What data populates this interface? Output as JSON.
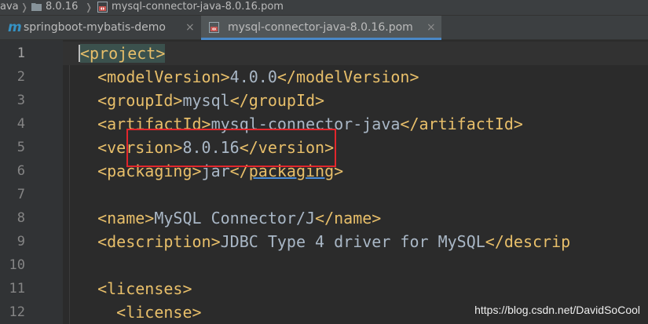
{
  "breadcrumb": {
    "items": [
      "ava",
      "8.0.16",
      "mysql-connector-java-8.0.16.pom"
    ]
  },
  "tabs": [
    {
      "label": "springboot-mybatis-demo",
      "icon": "maven-m-icon",
      "active": false
    },
    {
      "label": "mysql-connector-java-8.0.16.pom",
      "icon": "pom-file-icon",
      "active": true
    }
  ],
  "close_glyph": "×",
  "editor": {
    "line_numbers": [
      "1",
      "2",
      "3",
      "4",
      "5",
      "6",
      "7",
      "8",
      "9",
      "10",
      "11",
      "12"
    ],
    "lines": [
      {
        "indent": "",
        "segments": [
          {
            "t": "<project>",
            "c": "tag-match"
          }
        ]
      },
      {
        "indent": "  ",
        "segments": [
          {
            "t": "<modelVersion>",
            "c": "tag"
          },
          {
            "t": "4.0.0",
            "c": "text"
          },
          {
            "t": "</modelVersion>",
            "c": "tag"
          }
        ]
      },
      {
        "indent": "  ",
        "segments": [
          {
            "t": "<groupId>",
            "c": "tag"
          },
          {
            "t": "mysql",
            "c": "text"
          },
          {
            "t": "</groupId>",
            "c": "tag"
          }
        ]
      },
      {
        "indent": "  ",
        "segments": [
          {
            "t": "<artifactId>",
            "c": "tag"
          },
          {
            "t": "mysql-connector-java",
            "c": "text"
          },
          {
            "t": "</artifactId>",
            "c": "tag"
          }
        ]
      },
      {
        "indent": "  ",
        "segments": [
          {
            "t": "<version>",
            "c": "tag"
          },
          {
            "t": "8.0.16",
            "c": "text"
          },
          {
            "t": "</version>",
            "c": "tag"
          }
        ]
      },
      {
        "indent": "  ",
        "segments": [
          {
            "t": "<packaging>",
            "c": "tag"
          },
          {
            "t": "jar",
            "c": "text"
          },
          {
            "t": "</",
            "c": "tag"
          },
          {
            "t": "packaging",
            "c": "tag-warn"
          },
          {
            "t": ">",
            "c": "tag"
          }
        ]
      },
      {
        "indent": "",
        "segments": []
      },
      {
        "indent": "  ",
        "segments": [
          {
            "t": "<name>",
            "c": "tag"
          },
          {
            "t": "MySQL Connector/J",
            "c": "text"
          },
          {
            "t": "</name>",
            "c": "tag"
          }
        ]
      },
      {
        "indent": "  ",
        "segments": [
          {
            "t": "<description>",
            "c": "tag"
          },
          {
            "t": "JDBC Type 4 driver for MySQL",
            "c": "text"
          },
          {
            "t": "</descrip",
            "c": "tag"
          }
        ]
      },
      {
        "indent": "",
        "segments": []
      },
      {
        "indent": "  ",
        "segments": [
          {
            "t": "<licenses>",
            "c": "tag"
          }
        ]
      },
      {
        "indent": "    ",
        "segments": [
          {
            "t": "<license>",
            "c": "tag"
          }
        ]
      }
    ]
  },
  "watermark": "https://blog.csdn.net/DavidSoCool"
}
